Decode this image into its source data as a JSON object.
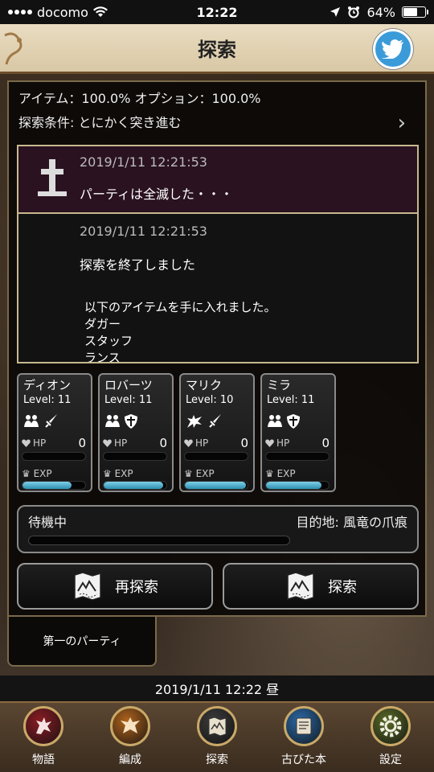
{
  "status_bar": {
    "carrier": "docomo",
    "time": "12:22",
    "battery": "64%",
    "battery_level": 0.64
  },
  "header": {
    "title": "探索",
    "share_icon": "twitter-bird-icon"
  },
  "info": {
    "rates": "アイテム：100.0%  オプション：100.0%",
    "condition": "探索条件: とにかく突き進む"
  },
  "log": {
    "entries": [
      {
        "timestamp": "2019/1/11  12:21:53",
        "message": "パーティは全滅した・・・",
        "icon": "gravestone-icon"
      },
      {
        "timestamp": "2019/1/11  12:21:53",
        "message": "探索を終了しました",
        "detail": "以下のアイテムを手に入れました。",
        "items": [
          "ダガー",
          "スタッフ",
          "ランス"
        ]
      }
    ]
  },
  "party": {
    "members": [
      {
        "name": "ディオン",
        "level": "Level: 11",
        "hp_label": "HP",
        "hp": "0",
        "exp_label": "EXP",
        "exp_pct": 78,
        "icons": [
          "human-icon",
          "sword-icon"
        ]
      },
      {
        "name": "ロバーツ",
        "level": "Level: 11",
        "hp_label": "HP",
        "hp": "0",
        "exp_label": "EXP",
        "exp_pct": 95,
        "icons": [
          "human-icon",
          "shield-icon"
        ]
      },
      {
        "name": "マリク",
        "level": "Level: 10",
        "hp_label": "HP",
        "hp": "0",
        "exp_label": "EXP",
        "exp_pct": 97,
        "icons": [
          "dragon-icon",
          "sword-icon"
        ]
      },
      {
        "name": "ミラ",
        "level": "Level: 11",
        "hp_label": "HP",
        "hp": "0",
        "exp_label": "EXP",
        "exp_pct": 88,
        "icons": [
          "human-icon",
          "shield-icon"
        ]
      }
    ]
  },
  "status": {
    "state": "待機中",
    "destination": "目的地: 風竜の爪痕"
  },
  "buttons": {
    "re_explore": "再探索",
    "explore": "探索"
  },
  "party_tab": "第一のパーティ",
  "datetime": "2019/1/11  12:22  昼",
  "nav": [
    {
      "label": "物語",
      "icon": "griffin-emblem-icon",
      "color": "#8a1c24"
    },
    {
      "label": "編成",
      "icon": "eagle-emblem-icon",
      "color": "#b0631c"
    },
    {
      "label": "探索",
      "icon": "map-scroll-icon",
      "color": "#3a3a3a"
    },
    {
      "label": "古びた本",
      "icon": "book-scroll-icon",
      "color": "#2a6aa8"
    },
    {
      "label": "設定",
      "icon": "gear-icon",
      "color": "#5a6a28"
    }
  ]
}
